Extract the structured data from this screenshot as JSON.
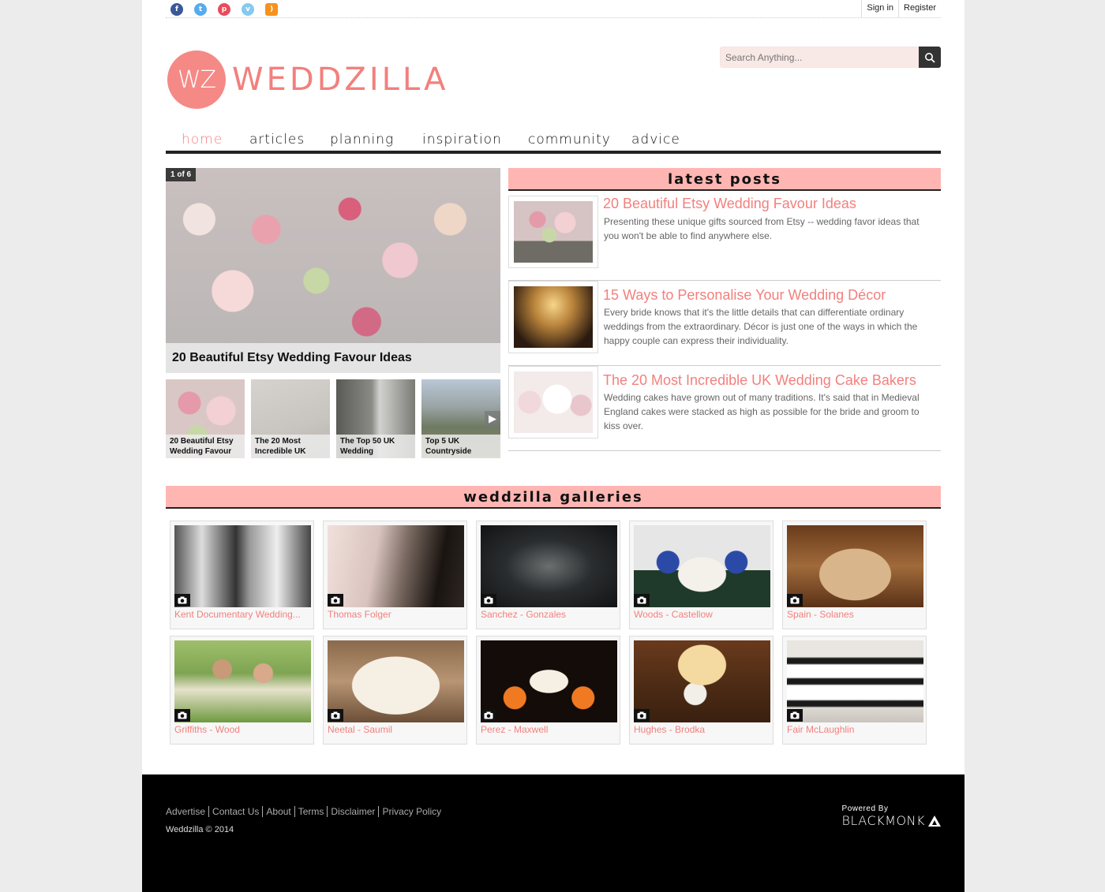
{
  "colors": {
    "accent": "#f2807d",
    "section_bg": "#ffb6b3",
    "footer_bg": "#000000"
  },
  "social": [
    {
      "name": "facebook",
      "icon": "facebook-icon",
      "color": "#3b5998",
      "glyph": "f"
    },
    {
      "name": "twitter",
      "icon": "twitter-icon",
      "color": "#55acee",
      "glyph": "t"
    },
    {
      "name": "pinterest",
      "icon": "pinterest-icon",
      "color": "#e94b5b",
      "glyph": "p"
    },
    {
      "name": "vimeo",
      "icon": "vimeo-icon",
      "color": "#86c9ef",
      "glyph": "v"
    },
    {
      "name": "rss",
      "icon": "rss-icon",
      "color": "#f6921e",
      "glyph": ")"
    }
  ],
  "auth": {
    "signin": "Sign in",
    "register": "Register"
  },
  "logo": {
    "badge": "WZ",
    "text": "WEDDZILLA"
  },
  "search": {
    "placeholder": "Search Anything..."
  },
  "nav": {
    "home": "home",
    "articles": "articles",
    "planning": "planning",
    "inspiration": "inspiration",
    "community": "community",
    "advice": "advice",
    "active": "home"
  },
  "slider": {
    "counter": "1 of 6",
    "caption": "20 Beautiful Etsy Wedding Favour Ideas",
    "thumbs": [
      {
        "caption": "20 Beautiful Etsy Wedding Favour"
      },
      {
        "caption": "The 20 Most Incredible UK"
      },
      {
        "caption": "The Top 50 UK Wedding"
      },
      {
        "caption": "Top 5 UK Countryside"
      }
    ]
  },
  "latest": {
    "heading": "latest posts",
    "posts": [
      {
        "title": "20 Beautiful Etsy Wedding Favour Ideas",
        "desc": "Presenting these unique gifts sourced from Etsy -- wedding favor ideas that you won't be able to find anywhere else."
      },
      {
        "title": "15 Ways to Personalise Your Wedding Décor",
        "desc": "Every bride knows that it's the little details that can differentiate ordinary weddings from the extraordinary. Décor is just one of the ways in which the happy couple can express their individuality."
      },
      {
        "title": "The 20 Most Incredible UK Wedding Cake Bakers",
        "desc": "Wedding cakes have grown out of many traditions. It's said that in Medieval England cakes were stacked as high as possible for the bride and groom to kiss over."
      }
    ]
  },
  "galleries": {
    "heading": "weddzilla galleries",
    "items": [
      {
        "label": "Kent Documentary Wedding..."
      },
      {
        "label": "Thomas Folger"
      },
      {
        "label": "Sanchez - Gonzales"
      },
      {
        "label": "Woods - Castellow"
      },
      {
        "label": "Spain - Solanes"
      },
      {
        "label": "Griffiths - Wood"
      },
      {
        "label": "Neetal - Saumil"
      },
      {
        "label": "Perez - Maxwell"
      },
      {
        "label": "Hughes - Brodka"
      },
      {
        "label": "Fair McLaughlin"
      }
    ]
  },
  "footer": {
    "links": [
      "Advertise",
      "Contact Us",
      "About",
      "Terms",
      "Disclaimer",
      "Privacy Policy"
    ],
    "copyright": "Weddzilla © 2014",
    "powered_by": "Powered By",
    "brand": "BLACKMONK"
  }
}
